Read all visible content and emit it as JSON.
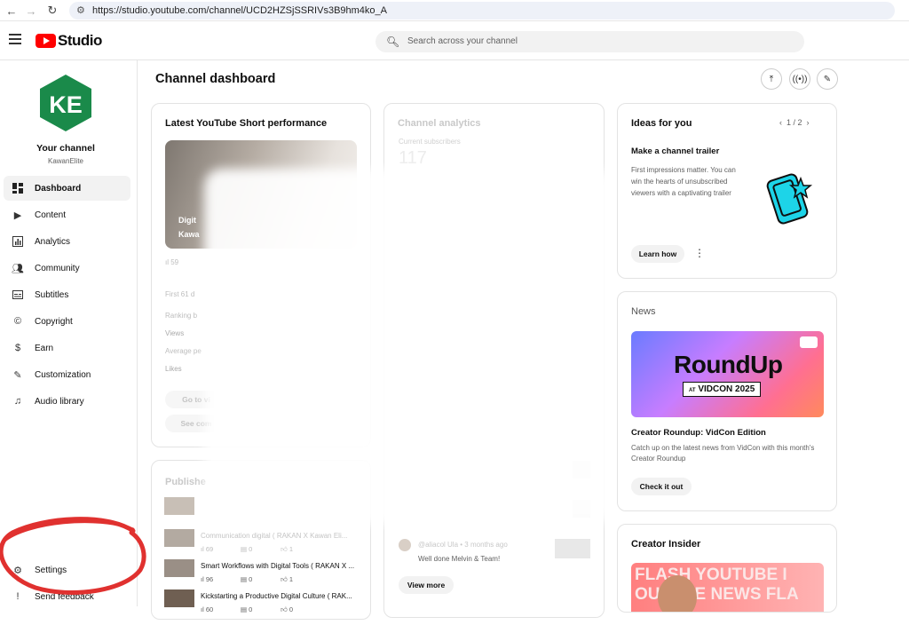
{
  "browser": {
    "url": "https://studio.youtube.com/channel/UCD2HZSjSSRIVs3B9hm4ko_A",
    "back_icon": "arrow-left-icon",
    "forward_icon": "arrow-right-icon",
    "reload_icon": "reload-icon"
  },
  "header": {
    "logo_text": "Studio",
    "search_placeholder": "Search across your channel"
  },
  "sidebar": {
    "your_channel": "Your channel",
    "handle": "KawanElite",
    "avatar_text": "KE",
    "items": [
      {
        "label": "Dashboard",
        "icon": "dashboard-icon",
        "active": true
      },
      {
        "label": "Content",
        "icon": "content-icon"
      },
      {
        "label": "Analytics",
        "icon": "analytics-icon"
      },
      {
        "label": "Community",
        "icon": "community-icon"
      },
      {
        "label": "Subtitles",
        "icon": "subtitles-icon"
      },
      {
        "label": "Copyright",
        "icon": "copyright-icon"
      },
      {
        "label": "Earn",
        "icon": "earn-icon"
      },
      {
        "label": "Customization",
        "icon": "customization-icon"
      },
      {
        "label": "Audio library",
        "icon": "audio-library-icon"
      }
    ],
    "settings": "Settings",
    "send_feedback": "Send feedback"
  },
  "main": {
    "title": "Channel dashboard"
  },
  "short_card": {
    "title": "Latest YouTube Short performance",
    "thumb_text_1": "Digit",
    "thumb_text_2": "Kawa",
    "views_partial": "59",
    "first_line": "First 61 d",
    "rows": [
      "Ranking b",
      "Views",
      "Average pe",
      "Likes"
    ],
    "go_to": "Go to vi",
    "see_comments": "See com"
  },
  "analytics_card": {
    "title": "Channel analytics",
    "subscribers_label": "Current subscribers",
    "subscribers_value": "117",
    "comment_author": "@aliacol Ula",
    "comment_time": "• 3 months ago",
    "comment_text": "Well done Melvin & Team!",
    "view_more": "View more"
  },
  "published_card": {
    "title": "Publishe",
    "rows": [
      {
        "title": "Communication digital ( RAKAN X Kawan Eli...",
        "views": "69",
        "comments": "0",
        "likes": "1"
      },
      {
        "title": "Smart Workflows with Digital Tools ( RAKAN X ...",
        "views": "96",
        "comments": "0",
        "likes": "1"
      },
      {
        "title": "Kickstarting a Productive Digital Culture ( RAK...",
        "views": "60",
        "comments": "0",
        "likes": "0"
      }
    ]
  },
  "ideas_card": {
    "title": "Ideas for you",
    "pager": "1 / 2",
    "idea_title": "Make a channel trailer",
    "idea_text": "First impressions matter. You can win the hearts of unsubscribed viewers with a captivating trailer",
    "learn_how": "Learn how"
  },
  "news_card": {
    "title": "News",
    "banner_title": "RoundUp",
    "banner_sub_at": "AT",
    "banner_sub": "VIDCON 2025",
    "headline": "Creator Roundup: VidCon Edition",
    "text": "Catch up on the latest news from VidCon with this month's Creator Roundup",
    "cta": "Check it out"
  },
  "insider_card": {
    "title": "Creator Insider",
    "banner_line1": "FLASH YOUTUBE I",
    "banner_line2": "OUTUBE NEWS FLA"
  },
  "colors": {
    "brand_red": "#ff0000",
    "avatar_green": "#1a8a4a",
    "swoosh_red": "#e0312f"
  }
}
